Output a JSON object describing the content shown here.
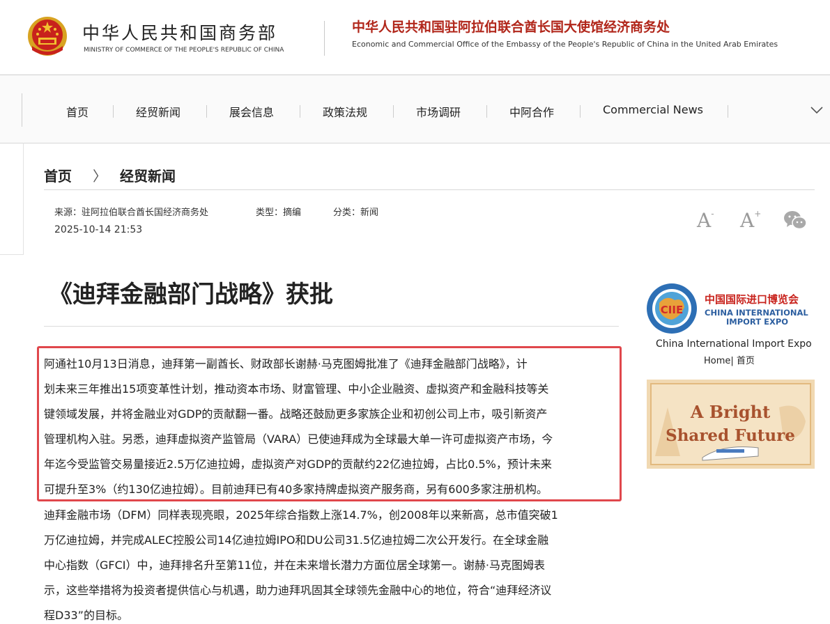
{
  "header": {
    "ministry_cn": "中华人民共和国商务部",
    "ministry_en": "MINISTRY OF COMMERCE OF THE PEOPLE'S REPUBLIC OF CHINA",
    "office_cn": "中华人民共和国驻阿拉伯联合酋长国大使馆经济商务处",
    "office_en": "Economic and Commercial Office of the Embassy of the People's Republic of China in the United Arab Emirates"
  },
  "nav": {
    "items": [
      "首页",
      "经贸新闻",
      "展会信息",
      "政策法规",
      "市场调研",
      "中阿合作",
      "Commercial News"
    ],
    "more_icon": "chevron-down-icon"
  },
  "breadcrumb": {
    "home": "首页",
    "separator": "〉",
    "current": "经贸新闻"
  },
  "meta": {
    "source": "来源：驻阿拉伯联合酋长国经济商务处",
    "type": "类型：摘编",
    "category": "分类：新闻",
    "date": "2025-10-14 21:53"
  },
  "tools": {
    "font_decrease": "A",
    "font_increase": "A",
    "share_icon": "wechat-icon"
  },
  "article": {
    "title": "《迪拜金融部门战略》获批",
    "lines": [
      "阿通社10月13日消息，迪拜第一副酋长、财政部长谢赫·马克图姆批准了《迪拜金融部门战略》，计",
      "划未来三年推出15项变革性计划，推动资本市场、财富管理、中小企业融资、虚拟资产和金融科技等关",
      "键领域发展，并将金融业对GDP的贡献翻一番。战略还鼓励更多家族企业和初创公司上市，吸引新资产",
      "管理机构入驻。另悉，迪拜虚拟资产监管局（VARA）已使迪拜成为全球最大单一许可虚拟资产市场，今",
      "年迄今受监管交易量接近2.5万亿迪拉姆，虚拟资产对GDP的贡献约22亿迪拉姆，占比0.5%，预计未来",
      "可提升至3%（约130亿迪拉姆）。目前迪拜已有40多家持牌虚拟资产服务商，另有600多家注册机构。",
      "迪拜金融市场（DFM）同样表现亮眼，2025年综合指数上涨14.7%，创2008年以来新高，总市值突破1",
      "万亿迪拉姆，并完成ALEC控股公司14亿迪拉姆IPO和DU公司31.5亿迪拉姆二次公开发行。在全球金融",
      "中心指数（GFCI）中，迪拜排名升至第11位，并在未来增长潜力方面位居全球第一。谢赫·马克图姆表",
      "示，这些举措将为投资者提供信心与机遇，助力迪拜巩固其全球领先金融中心的地位，符合“迪拜经济议",
      "程D33”的目标。"
    ],
    "highlight_color": "#e0474c"
  },
  "sidebar": {
    "ciie_logo_cn": "中国国际进口博览会",
    "ciie_logo_en1": "CHINA INTERNATIONAL",
    "ciie_logo_en2": "IMPORT EXPO",
    "ciie_logo_mark": "CIIE",
    "ciie_caption": "China International Import Expo",
    "ciie_home": "Home| 首页",
    "banner_line1": "A Bright",
    "banner_line2": "Shared Future"
  },
  "colors": {
    "brand_red": "#b1261a",
    "banner_bg": "#f1d9b2"
  }
}
